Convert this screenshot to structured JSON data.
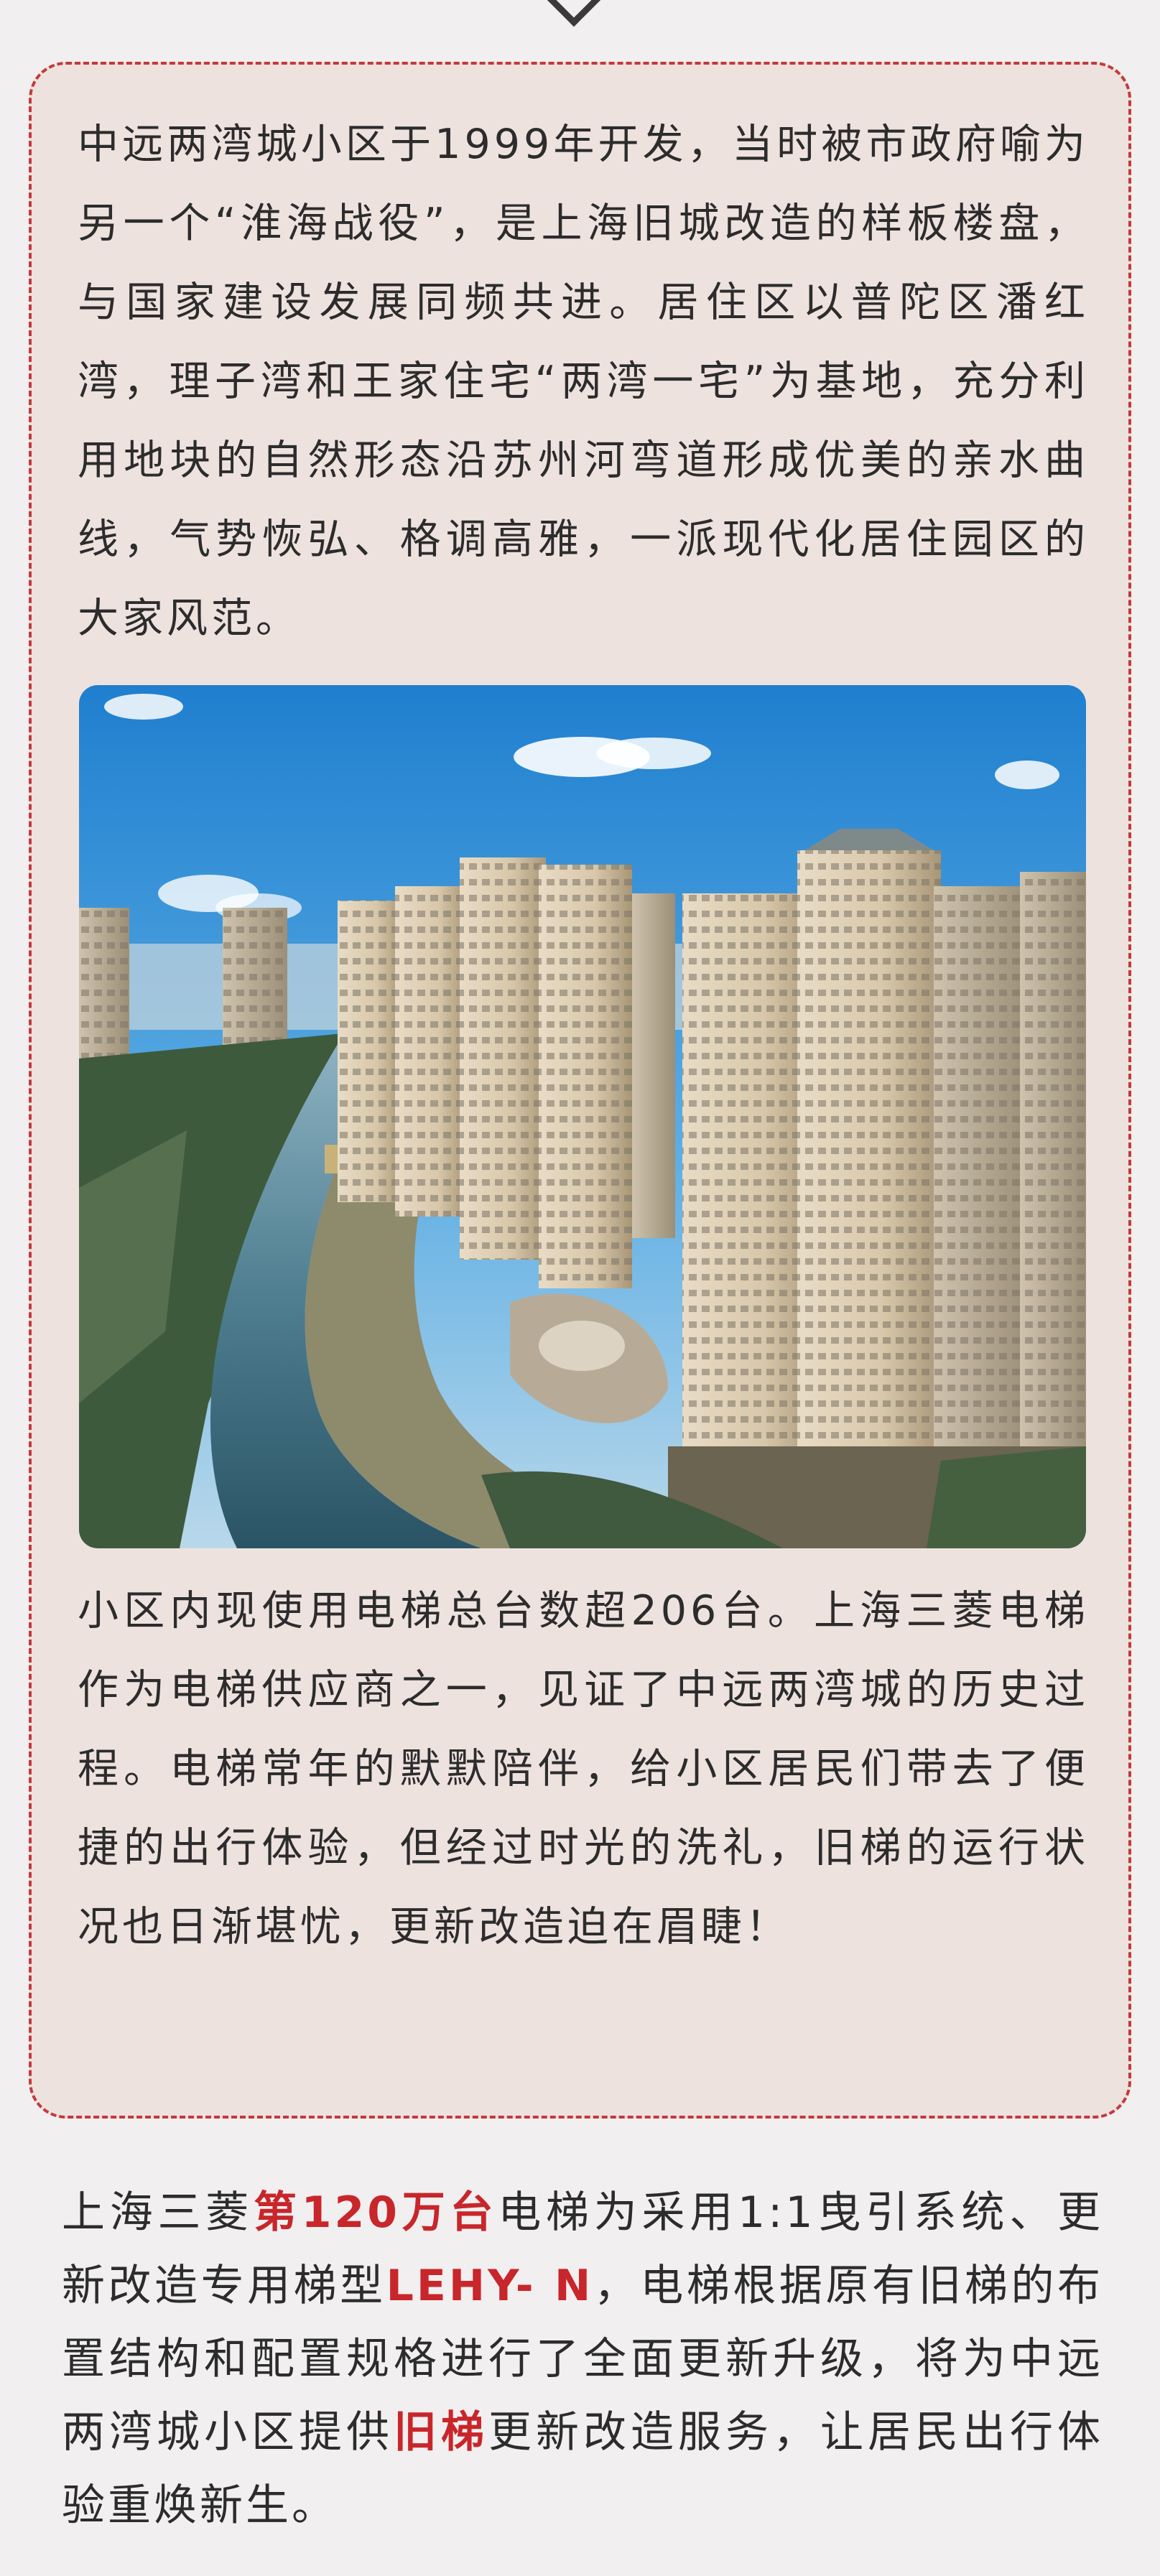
{
  "intro": {
    "text": "中远两湾城小区于1999年开发，当时被市政府喻为另一个“淮海战役”，是上海旧城改造的样板楼盘，与国家建设发展同频共进。居住区以普陀区潘红湾，理子湾和王家住宅“两湾一宅”为基地，充分利用地块的自然形态沿苏州河弯道形成优美的亲水曲线，气势恢弘、格调高雅，一派现代化居住园区的大家风范。"
  },
  "elevator_history": {
    "text": "小区内现使用电梯总台数超206台。上海三菱电梯作为电梯供应商之一，见证了中远两湾城的历史过程。电梯常年的默默陪伴，给小区居民们带去了便捷的出行体验，但经过时光的洗礼，旧梯的运行状况也日渐堪忧，更新改造迫在眉睫！"
  },
  "upgrade": {
    "part1": "上海三菱",
    "highlight1": "第120万台",
    "part2": "电梯为采用1:1曳引系统、更新改造专用梯型",
    "highlight2": "LEHY- N",
    "part3": "，电梯根据原有旧梯的布置结构和配置规格进行了全面更新升级，将为中远两湾城小区提供",
    "highlight3": "旧梯",
    "part4": "更新改造服务，让居民出行体验重焕新生。"
  },
  "colors": {
    "highlight": "#c8262a",
    "card_border": "#c33a3a",
    "card_background": "#eee2df",
    "page_background": "#f1eff0"
  }
}
